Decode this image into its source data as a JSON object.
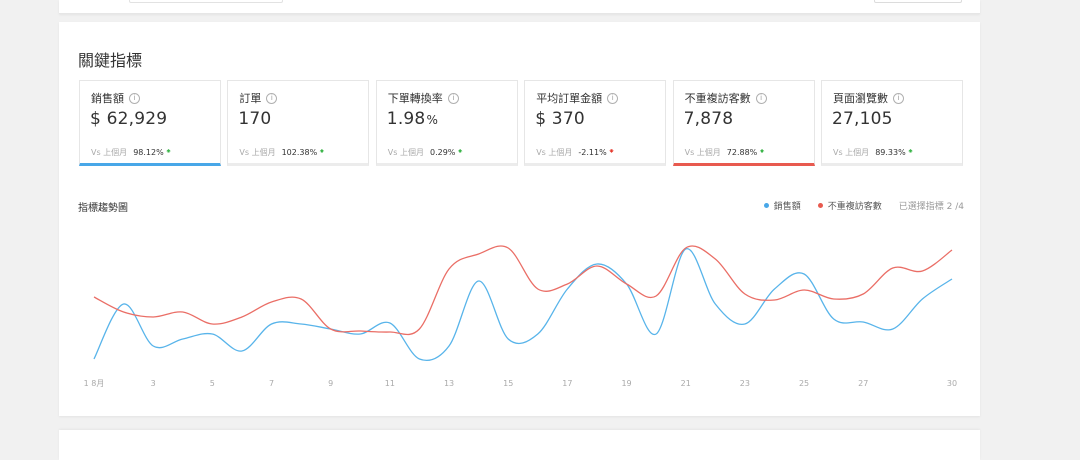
{
  "section_title": "關鍵指標",
  "kpis": [
    {
      "label": "銷售額",
      "value": "$ 62,929",
      "unit": "",
      "compare_label": "Vs 上個月",
      "change": "98.12%",
      "direction": "up",
      "selected_color": "#48a7e8"
    },
    {
      "label": "訂單",
      "value": "170",
      "unit": "",
      "compare_label": "Vs 上個月",
      "change": "102.38%",
      "direction": "up",
      "selected_color": ""
    },
    {
      "label": "下單轉換率",
      "value": "1.98",
      "unit": "%",
      "compare_label": "Vs 上個月",
      "change": "0.29%",
      "direction": "up",
      "selected_color": ""
    },
    {
      "label": "平均訂單金額",
      "value": "$ 370",
      "unit": "",
      "compare_label": "Vs 上個月",
      "change": "-2.11%",
      "direction": "down",
      "selected_color": ""
    },
    {
      "label": "不重複訪客數",
      "value": "7,878",
      "unit": "",
      "compare_label": "Vs 上個月",
      "change": "72.88%",
      "direction": "up",
      "selected_color": "#e85a4f"
    },
    {
      "label": "頁面瀏覽數",
      "value": "27,105",
      "unit": "",
      "compare_label": "Vs 上個月",
      "change": "89.33%",
      "direction": "up",
      "selected_color": ""
    }
  ],
  "chart": {
    "title": "指標趨勢圖",
    "selected_count": "已選擇指標 2 /4"
  },
  "chart_data": {
    "type": "line",
    "title": "指標趨勢圖",
    "x": [
      1,
      2,
      3,
      4,
      5,
      6,
      7,
      8,
      9,
      10,
      11,
      12,
      13,
      14,
      15,
      16,
      17,
      18,
      19,
      20,
      21,
      22,
      23,
      24,
      25,
      26,
      27,
      28,
      29,
      30
    ],
    "x_tick_labels": [
      "1 8月",
      "3",
      "5",
      "7",
      "9",
      "11",
      "13",
      "15",
      "17",
      "19",
      "21",
      "23",
      "25",
      "27",
      "30"
    ],
    "y_axis_visible": false,
    "grid": false,
    "legend_position": "top-right",
    "series": [
      {
        "name": "銷售額",
        "color": "#58b4ea",
        "values": [
          5,
          60,
          18,
          25,
          30,
          13,
          40,
          40,
          35,
          30,
          41,
          5,
          18,
          83,
          25,
          30,
          75,
          100,
          80,
          30,
          115,
          60,
          40,
          75,
          90,
          45,
          42,
          35,
          65,
          85
        ]
      },
      {
        "name": "不重複訪客數",
        "color": "#ea6e66",
        "values": [
          67,
          52,
          47,
          52,
          40,
          47,
          62,
          65,
          35,
          33,
          32,
          35,
          95,
          110,
          116,
          75,
          80,
          98,
          80,
          68,
          116,
          105,
          70,
          64,
          74,
          65,
          70,
          96,
          93,
          114
        ]
      }
    ]
  }
}
